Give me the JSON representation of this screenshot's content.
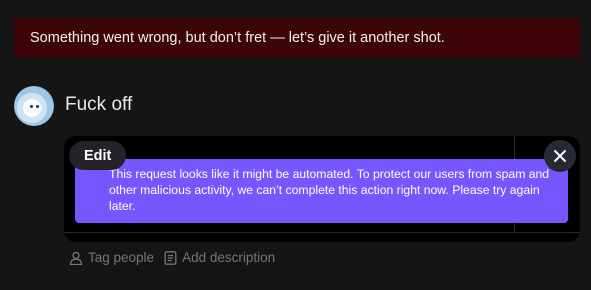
{
  "error_banner": {
    "message": "Something went wrong, but don’t fret — let’s give it another shot."
  },
  "post": {
    "text": "Fuck off"
  },
  "media": {
    "edit_label": "Edit",
    "close_icon": "close-icon",
    "toast_message": "This request looks like it might be automated. To protect our users from spam and other malicious activity, we can’t complete this action right now. Please try again later."
  },
  "actions": {
    "tag_people_label": "Tag people",
    "add_description_label": "Add description",
    "tag_icon": "person-icon",
    "description_icon": "document-icon"
  },
  "colors": {
    "background": "#151515",
    "error_bg": "#3d0508",
    "toast_bg": "#7856ff",
    "muted_text": "#71767b"
  }
}
